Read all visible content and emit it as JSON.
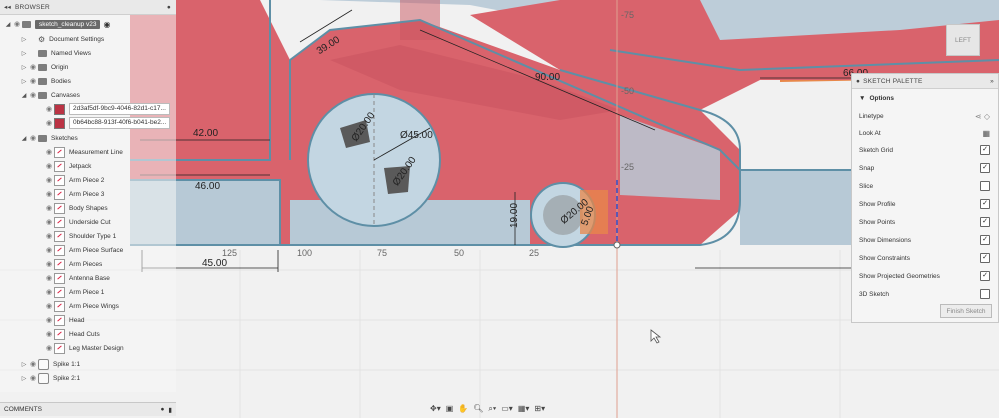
{
  "browser": {
    "title": "BROWSER",
    "root": "sketch_cleanup v23",
    "items": [
      {
        "label": "Document Settings"
      },
      {
        "label": "Named Views"
      },
      {
        "label": "Origin"
      },
      {
        "label": "Bodies"
      },
      {
        "label": "Canvases"
      },
      {
        "label": "2d3af5df-9bc9-4046-82d1-c17..."
      },
      {
        "label": "0b64bc88-913f-40f6-b041-be2..."
      },
      {
        "label": "Sketches"
      }
    ],
    "sketches": [
      "Measurement Line",
      "Jetpack",
      "Arm Piece 2",
      "Arm Piece 3",
      "Body Shapes",
      "Underside Cut",
      "Shoulder Type 1",
      "Arm Piece Surface",
      "Arm Pieces",
      "Antenna Base",
      "Arm Piece 1",
      "Arm Piece Wings",
      "Head",
      "Head Cuts",
      "Leg Master Design"
    ],
    "components": [
      "Spike 1:1",
      "Spike 2:1"
    ]
  },
  "comments": {
    "title": "COMMENTS"
  },
  "palette": {
    "title": "SKETCH PALETTE",
    "section": "Options",
    "options": [
      {
        "label": "Linetype",
        "type": "linetype"
      },
      {
        "label": "Look At",
        "type": "icon"
      },
      {
        "label": "Sketch Grid",
        "checked": true
      },
      {
        "label": "Snap",
        "checked": true
      },
      {
        "label": "Slice",
        "checked": false
      },
      {
        "label": "Show Profile",
        "checked": true
      },
      {
        "label": "Show Points",
        "checked": true
      },
      {
        "label": "Show Dimensions",
        "checked": true
      },
      {
        "label": "Show Constraints",
        "checked": true
      },
      {
        "label": "Show Projected Geometries",
        "checked": true
      },
      {
        "label": "3D Sketch",
        "checked": false
      }
    ],
    "finish": "Finish Sketch"
  },
  "viewcube": {
    "face": "LEFT"
  },
  "dimensions": {
    "d39": "39.00",
    "d90": "90.00",
    "d42": "42.00",
    "d46": "46.00",
    "d45a": "Ø45.00",
    "d19": "19.00",
    "d45b": "45.00",
    "d66": "66.00",
    "d20a": "Ø20.00",
    "d20b": "Ø20.00",
    "d20c": "Ø20.00",
    "d5": "5.00"
  },
  "axis": {
    "h": [
      "125",
      "100",
      "75",
      "50",
      "25"
    ],
    "v": [
      "-75",
      "-50",
      "-25"
    ]
  },
  "colors": {
    "red": "#d9636c",
    "blue": "#b4c9d8",
    "orange": "#e8874a",
    "line": "#5e8fa6"
  }
}
